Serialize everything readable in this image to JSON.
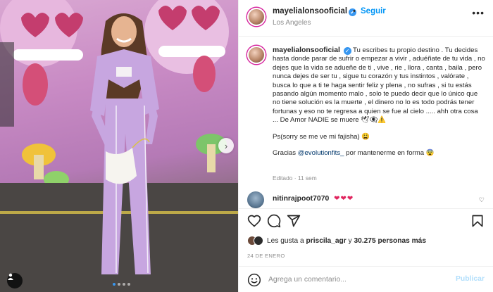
{
  "post": {
    "username": "mayelialonsooficial",
    "separator": "•",
    "follow_label": "Seguir",
    "location": "Los Angeles",
    "more_label": "•••"
  },
  "photo": {
    "next_arrow": "›",
    "slide_count": 4,
    "active_slide": 1
  },
  "caption": {
    "username": "mayelialonsooficial",
    "paragraph_1": "Tu escribes tu propio destino . Tu decides hasta donde parar de sufrir o empezar a vivir , aduéñate de tu vida , no dejes que la vida se adueñe de ti , vive , rie , llora , canta , baila , pero nunca dejes de ser tu , sigue tu corazón y tus instintos , valórate , busca lo que a ti te haga sentir feliz y plena , no sufras , si tu estás pasando algún momento malo , solo te puedo decir que lo único que no tiene solución es la muerte , el dinero no lo es todo podrás tener fortunas y eso no te regresa a quien se fue al cielo ..... ahh otra cosa ... De Amor NADIE se muere 🕊👁‍🗨⚠️",
    "paragraph_2": "Ps(sorry se me ve mi fajisha) 😩",
    "thanks_prefix": "Gracias ",
    "mention": "@evolutionfits_",
    "thanks_suffix": " por mantenerme en forma 😨",
    "edited": "Editado · 11 sem"
  },
  "comment": {
    "username": "nitinrajpoot7070",
    "text": "❤❤❤",
    "like_icon": "♡"
  },
  "likes": {
    "prefix": "Les gusta a ",
    "user": "priscila_agr",
    "middle": " y ",
    "count": "30.275 personas más"
  },
  "date": "24 DE ENERO",
  "add_comment": {
    "placeholder": "Agrega un comentario...",
    "publish_label": "Publicar"
  },
  "colors": {
    "accent": "#0095f6",
    "verified": "#3897f0",
    "heart": "#e0245e",
    "suit": "#c7a6e0",
    "wall": "#d9a7d2"
  },
  "icons": [
    "verified-icon",
    "like-icon",
    "comment-icon",
    "share-icon",
    "save-icon",
    "emoji-icon",
    "next-arrow-icon",
    "tag-user-icon"
  ]
}
